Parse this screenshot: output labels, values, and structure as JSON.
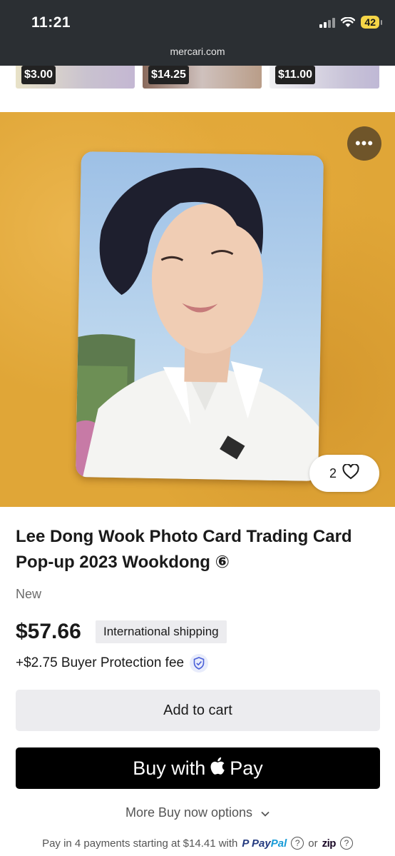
{
  "status_bar": {
    "time": "11:21",
    "battery": "42"
  },
  "browser": {
    "url": "mercari.com"
  },
  "recommended": [
    {
      "price": "$3.00"
    },
    {
      "price": "$14.25"
    },
    {
      "price": "$11.00"
    }
  ],
  "product": {
    "title": "Lee Dong Wook Photo Card Trading Card Pop-up 2023 Wookdong ⑥",
    "condition": "New",
    "price": "$57.66",
    "shipping_badge": "International shipping",
    "fee": "+$2.75 Buyer Protection fee",
    "likes": "2",
    "more_glyph": "•••"
  },
  "actions": {
    "add_to_cart": "Add to cart",
    "buy_with": "Buy with",
    "pay": "Pay",
    "more_options": "More Buy now options"
  },
  "installments": {
    "text": "Pay in 4 payments starting at $14.41 with",
    "paypal_a": "Pay",
    "paypal_b": "Pal",
    "or": "or",
    "zip": "zip",
    "help": "?"
  },
  "colors": {
    "hero_background": "#e0a637",
    "topbar": "#2b2f33",
    "battery": "#f5d547",
    "paypal_blue": "#253b80",
    "paypal_light": "#179bd7"
  }
}
